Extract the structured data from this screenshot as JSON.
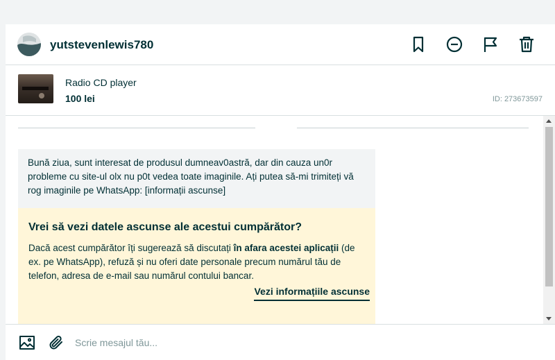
{
  "header": {
    "username": "yutstevenlewis780",
    "icons": [
      "avatar",
      "bookmark-icon",
      "block-icon",
      "report-flag-icon",
      "trash-icon"
    ]
  },
  "ad": {
    "title": "Radio CD player",
    "price": "100 lei",
    "id_label": "ID: 273673597"
  },
  "message": {
    "text": "Bună ziua, sunt interesat de produsul dumneav0astră, dar din cauza un0r probleme cu site-ul olx nu p0t vedea toate imaginile. Ați putea să-mi trimiteți vă rog imaginile pe WhatsApp: [informații ascunse]"
  },
  "warning": {
    "title": "Vrei să vezi datele ascunse ale acestui cumpărător?",
    "body_prefix": "Dacă acest cumpărător îți sugerează să discutați ",
    "body_bold": "în afara acestei aplicații",
    "body_suffix": " (de ex. pe WhatsApp), refuză și nu oferi date personale precum numărul tău de telefon, adresa de e-mail sau numărul contului bancar.",
    "link_label": "Vezi informațiile ascunse",
    "background": "#fff6d9"
  },
  "composer": {
    "placeholder": "Scrie mesajul tău...",
    "icons": [
      "image-icon",
      "paperclip-icon"
    ]
  },
  "colors": {
    "text": "#002f34",
    "muted": "#7f9799",
    "bubble": "#f2f4f5"
  }
}
